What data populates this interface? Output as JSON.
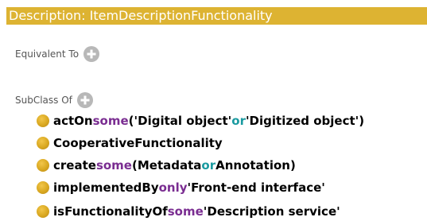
{
  "header": {
    "title": "Description: ItemDescriptionFunctionality"
  },
  "equivalent_to": {
    "label": "Equivalent To"
  },
  "subclass_of": {
    "label": "SubClass Of",
    "axioms": [
      {
        "parts": [
          "actOn ",
          "some",
          " ('Digital object' ",
          "or",
          " 'Digitized object')"
        ]
      },
      {
        "parts": [
          "CooperativeFunctionality"
        ]
      },
      {
        "parts": [
          "create ",
          "some",
          " (Metadata ",
          "or",
          " Annotation)"
        ]
      },
      {
        "parts": [
          "implementedBy ",
          "only",
          " 'Front-end interface'"
        ]
      },
      {
        "parts": [
          "isFunctionalityOf ",
          "some",
          " 'Description service'"
        ]
      }
    ]
  },
  "colors": {
    "header_bg": "#ddb332",
    "keyword_quantifier": "#7a2d91",
    "keyword_or": "#1a9aa0",
    "bullet": "#d9a820"
  },
  "icons": {
    "add": "plus-circle-icon",
    "bullet": "class-bullet-icon"
  }
}
